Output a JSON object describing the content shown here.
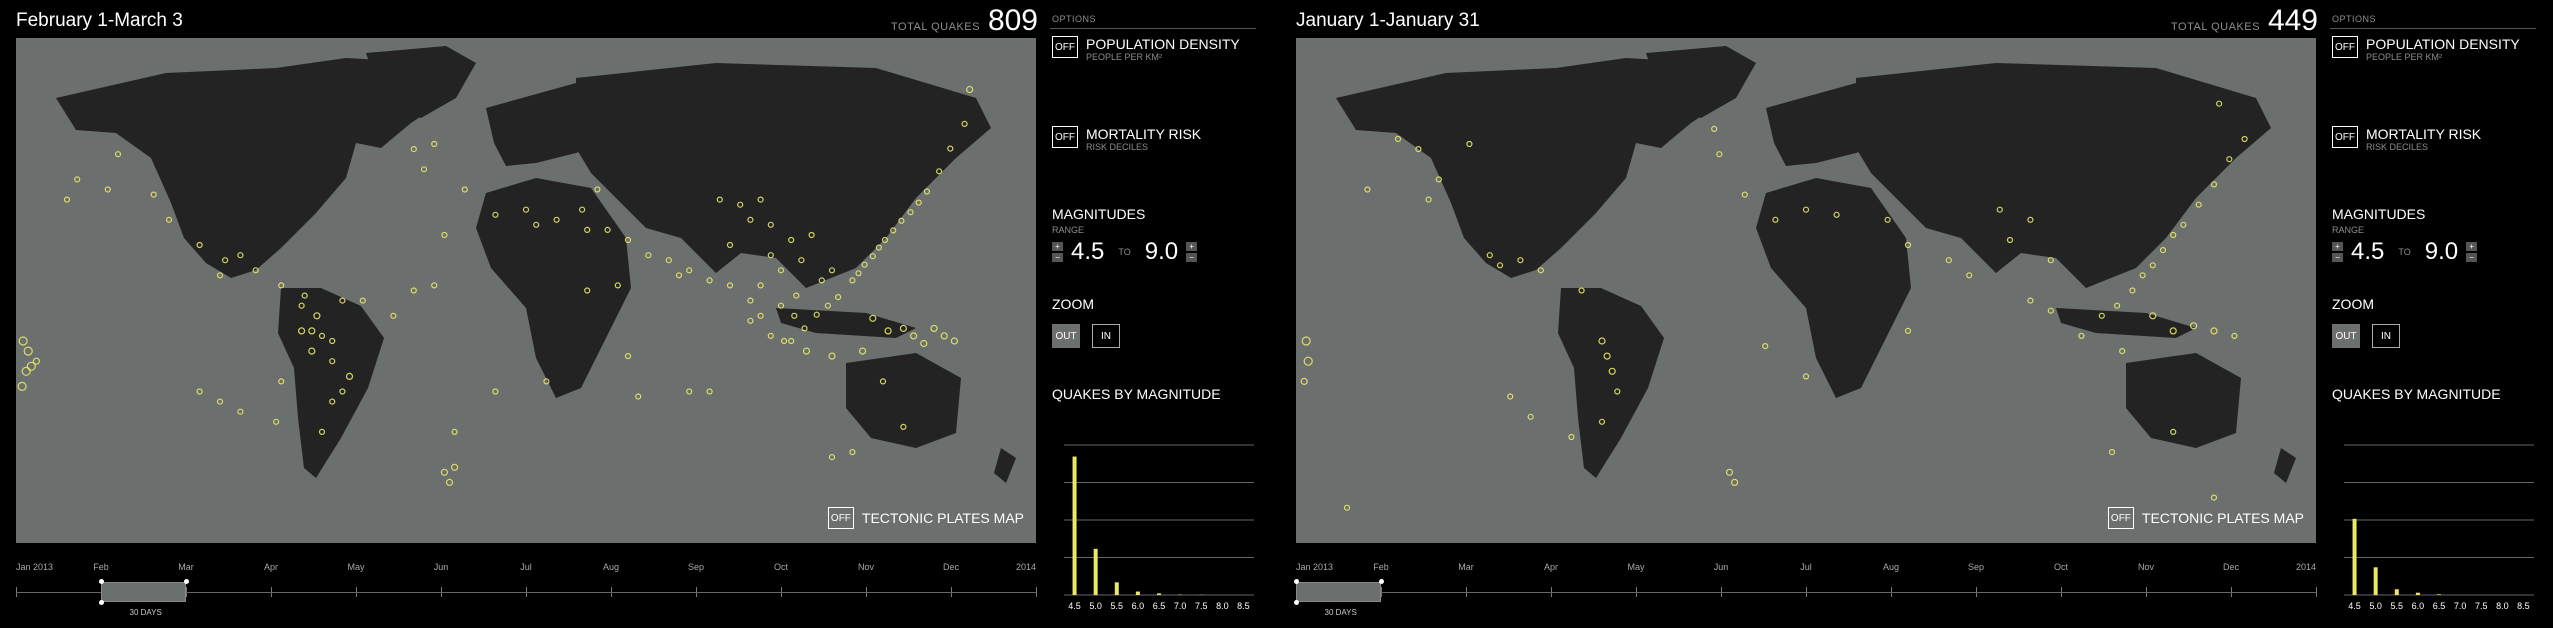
{
  "colors": {
    "map_ocean": "#6b6f6d",
    "land": "#232323",
    "quake": "#e8e86a",
    "background": "#000000"
  },
  "screens": [
    {
      "period_title": "February 1-March 3",
      "total_label": "TOTAL QUAKES",
      "total_value": "809",
      "tectonic_toggle": {
        "state": "OFF",
        "label": "TECTONIC PLATES MAP"
      },
      "timeline": {
        "months": [
          "Jan 2013",
          "Feb",
          "Mar",
          "Apr",
          "May",
          "Jun",
          "Jul",
          "Aug",
          "Sep",
          "Oct",
          "Nov",
          "Dec",
          "2014"
        ],
        "window_label": "30 DAYS",
        "window_start_month": 1,
        "window_span_months": 1.0
      },
      "options": {
        "heading": "OPTIONS",
        "population": {
          "state": "OFF",
          "title": "POPULATION DENSITY",
          "subtitle": "PEOPLE PER KM²"
        },
        "mortality": {
          "state": "OFF",
          "title": "MORTALITY RISK",
          "subtitle": "RISK DECILES"
        },
        "magnitudes": {
          "title": "MAGNITUDES",
          "range_label": "RANGE",
          "min": "4.5",
          "to": "TO",
          "max": "9.0"
        },
        "zoom": {
          "title": "ZOOM",
          "out": "OUT",
          "in": "IN",
          "active": "out"
        },
        "histogram_title": "QUAKES BY MAGNITUDE"
      },
      "chart_data": {
        "type": "bar",
        "categories": [
          "4.5",
          "5.0",
          "5.5",
          "6.0",
          "6.5",
          "7.0",
          "7.5",
          "8.0",
          "8.5"
        ],
        "values": [
          600,
          200,
          55,
          15,
          7,
          2,
          1,
          0,
          0
        ]
      },
      "quakes": [
        [
          0.935,
          0.102,
          2
        ],
        [
          0.916,
          0.219,
          1.5
        ],
        [
          0.905,
          0.264,
          1.5
        ],
        [
          0.893,
          0.304,
          1.5
        ],
        [
          0.885,
          0.326,
          1.5
        ],
        [
          0.877,
          0.345,
          1.5
        ],
        [
          0.868,
          0.362,
          1.5
        ],
        [
          0.86,
          0.381,
          1.5
        ],
        [
          0.852,
          0.4,
          1.5
        ],
        [
          0.846,
          0.415,
          1.5
        ],
        [
          0.84,
          0.432,
          1.5
        ],
        [
          0.832,
          0.449,
          1.5
        ],
        [
          0.826,
          0.466,
          1.5
        ],
        [
          0.82,
          0.48,
          1.5
        ],
        [
          0.806,
          0.513,
          1.5
        ],
        [
          0.796,
          0.53,
          1.5
        ],
        [
          0.785,
          0.548,
          1.5
        ],
        [
          0.773,
          0.575,
          1.5
        ],
        [
          0.753,
          0.6,
          1.5
        ],
        [
          0.72,
          0.56,
          1.5
        ],
        [
          0.73,
          0.55,
          1.5
        ],
        [
          0.79,
          0.48,
          1.5
        ],
        [
          0.8,
          0.46,
          1.5
        ],
        [
          0.84,
          0.555,
          2
        ],
        [
          0.87,
          0.575,
          2
        ],
        [
          0.88,
          0.59,
          2
        ],
        [
          0.9,
          0.575,
          2
        ],
        [
          0.91,
          0.59,
          2
        ],
        [
          0.92,
          0.6,
          2
        ],
        [
          0.89,
          0.605,
          2
        ],
        [
          0.855,
          0.58,
          2
        ],
        [
          0.83,
          0.62,
          2
        ],
        [
          0.8,
          0.63,
          2
        ],
        [
          0.775,
          0.62,
          2
        ],
        [
          0.76,
          0.6,
          1.5
        ],
        [
          0.74,
          0.59,
          1.5
        ],
        [
          0.765,
          0.51,
          1.5
        ],
        [
          0.763,
          0.55,
          1.5
        ],
        [
          0.75,
          0.53,
          1.5
        ],
        [
          0.73,
          0.49,
          1.5
        ],
        [
          0.72,
          0.52,
          1.5
        ],
        [
          0.7,
          0.49,
          1.5
        ],
        [
          0.68,
          0.48,
          1.5
        ],
        [
          0.66,
          0.46,
          1.5
        ],
        [
          0.64,
          0.44,
          1.5
        ],
        [
          0.62,
          0.43,
          1.5
        ],
        [
          0.6,
          0.4,
          1.5
        ],
        [
          0.58,
          0.38,
          1.5
        ],
        [
          0.56,
          0.38,
          1.5
        ],
        [
          0.555,
          0.34,
          1.5
        ],
        [
          0.57,
          0.3,
          1.5
        ],
        [
          0.72,
          0.36,
          1.5
        ],
        [
          0.74,
          0.37,
          1.5
        ],
        [
          0.76,
          0.4,
          1.5
        ],
        [
          0.78,
          0.39,
          1.5
        ],
        [
          0.7,
          0.41,
          1.5
        ],
        [
          0.74,
          0.43,
          1.5
        ],
        [
          0.77,
          0.44,
          1.5
        ],
        [
          0.75,
          0.46,
          1.5
        ],
        [
          0.71,
          0.33,
          1.5
        ],
        [
          0.69,
          0.32,
          1.5
        ],
        [
          0.73,
          0.32,
          1.5
        ],
        [
          0.53,
          0.36,
          1.5
        ],
        [
          0.51,
          0.37,
          1.5
        ],
        [
          0.5,
          0.34,
          1.5
        ],
        [
          0.47,
          0.35,
          1.5
        ],
        [
          0.44,
          0.3,
          1.5
        ],
        [
          0.42,
          0.39,
          1.5
        ],
        [
          0.31,
          0.64,
          1.5
        ],
        [
          0.3,
          0.59,
          1.5
        ],
        [
          0.31,
          0.6,
          1.5
        ],
        [
          0.327,
          0.67,
          2
        ],
        [
          0.32,
          0.7,
          1.5
        ],
        [
          0.31,
          0.72,
          1.5
        ],
        [
          0.3,
          0.78,
          1.5
        ],
        [
          0.29,
          0.58,
          2
        ],
        [
          0.28,
          0.53,
          1.5
        ],
        [
          0.26,
          0.49,
          1.5
        ],
        [
          0.235,
          0.46,
          1.5
        ],
        [
          0.22,
          0.43,
          1.5
        ],
        [
          0.205,
          0.44,
          1.5
        ],
        [
          0.18,
          0.41,
          1.5
        ],
        [
          0.2,
          0.47,
          1.5
        ],
        [
          0.283,
          0.51,
          1.5
        ],
        [
          0.29,
          0.62,
          2
        ],
        [
          0.295,
          0.55,
          2
        ],
        [
          0.28,
          0.58,
          2
        ],
        [
          0.32,
          0.52,
          1.5
        ],
        [
          0.34,
          0.52,
          1.5
        ],
        [
          0.37,
          0.55,
          1.5
        ],
        [
          0.39,
          0.5,
          1.5
        ],
        [
          0.41,
          0.49,
          1.5
        ],
        [
          0.47,
          0.7,
          1.5
        ],
        [
          0.43,
          0.78,
          1.5
        ],
        [
          0.42,
          0.86,
          2
        ],
        [
          0.43,
          0.85,
          2
        ],
        [
          0.425,
          0.88,
          2
        ],
        [
          0.255,
          0.76,
          1.5
        ],
        [
          0.26,
          0.68,
          1.5
        ],
        [
          0.22,
          0.74,
          1.5
        ],
        [
          0.2,
          0.72,
          1.5
        ],
        [
          0.18,
          0.7,
          1.5
        ],
        [
          0.1,
          0.23,
          1.5
        ],
        [
          0.09,
          0.3,
          1.5
        ],
        [
          0.06,
          0.28,
          1.5
        ],
        [
          0.05,
          0.32,
          1.5
        ],
        [
          0.135,
          0.31,
          1.5
        ],
        [
          0.15,
          0.36,
          1.5
        ],
        [
          0.39,
          0.22,
          1.5
        ],
        [
          0.4,
          0.26,
          1.5
        ],
        [
          0.41,
          0.21,
          1.5
        ],
        [
          0.007,
          0.6,
          3
        ],
        [
          0.012,
          0.62,
          3
        ],
        [
          0.015,
          0.65,
          3
        ],
        [
          0.01,
          0.66,
          3
        ],
        [
          0.006,
          0.69,
          3
        ],
        [
          0.02,
          0.64,
          2
        ],
        [
          0.61,
          0.71,
          1.5
        ],
        [
          0.66,
          0.7,
          1.5
        ],
        [
          0.68,
          0.7,
          1.5
        ],
        [
          0.8,
          0.83,
          1.5
        ],
        [
          0.82,
          0.82,
          1.5
        ],
        [
          0.87,
          0.77,
          1.5
        ],
        [
          0.85,
          0.68,
          1.5
        ],
        [
          0.56,
          0.5,
          1.5
        ],
        [
          0.59,
          0.49,
          1.5
        ],
        [
          0.65,
          0.47,
          1.5
        ],
        [
          0.6,
          0.63,
          1.5
        ],
        [
          0.52,
          0.68,
          1.5
        ],
        [
          0.93,
          0.17,
          1.5
        ]
      ]
    },
    {
      "period_title": "January 1-January 31",
      "total_label": "TOTAL QUAKES",
      "total_value": "449",
      "tectonic_toggle": {
        "state": "OFF",
        "label": "TECTONIC PLATES MAP"
      },
      "timeline": {
        "months": [
          "Jan 2013",
          "Feb",
          "Mar",
          "Apr",
          "May",
          "Jun",
          "Jul",
          "Aug",
          "Sep",
          "Oct",
          "Nov",
          "Dec",
          "2014"
        ],
        "window_label": "30 DAYS",
        "window_start_month": 0,
        "window_span_months": 1.0
      },
      "options": {
        "heading": "OPTIONS",
        "population": {
          "state": "OFF",
          "title": "POPULATION DENSITY",
          "subtitle": "PEOPLE PER KM²"
        },
        "mortality": {
          "state": "OFF",
          "title": "MORTALITY RISK",
          "subtitle": "RISK DECILES"
        },
        "magnitudes": {
          "title": "MAGNITUDES",
          "range_label": "RANGE",
          "min": "4.5",
          "to": "TO",
          "max": "9.0"
        },
        "zoom": {
          "title": "ZOOM",
          "out": "OUT",
          "in": "IN",
          "active": "out"
        },
        "histogram_title": "QUAKES BY MAGNITUDE"
      },
      "chart_data": {
        "type": "bar",
        "categories": [
          "4.5",
          "5.0",
          "5.5",
          "6.0",
          "6.5",
          "7.0",
          "7.5",
          "8.0",
          "8.5"
        ],
        "values": [
          330,
          120,
          25,
          10,
          3,
          0,
          0,
          0,
          0
        ]
      },
      "quakes": [
        [
          0.905,
          0.13,
          1.5
        ],
        [
          0.93,
          0.2,
          1.5
        ],
        [
          0.915,
          0.24,
          1.5
        ],
        [
          0.9,
          0.29,
          1.5
        ],
        [
          0.885,
          0.33,
          1.5
        ],
        [
          0.87,
          0.37,
          1.5
        ],
        [
          0.86,
          0.39,
          1.5
        ],
        [
          0.85,
          0.42,
          1.5
        ],
        [
          0.84,
          0.45,
          1.5
        ],
        [
          0.83,
          0.47,
          1.5
        ],
        [
          0.82,
          0.5,
          1.5
        ],
        [
          0.805,
          0.53,
          1.5
        ],
        [
          0.79,
          0.55,
          1.5
        ],
        [
          0.77,
          0.59,
          1.5
        ],
        [
          0.84,
          0.55,
          2
        ],
        [
          0.86,
          0.58,
          2
        ],
        [
          0.88,
          0.57,
          2
        ],
        [
          0.9,
          0.58,
          2
        ],
        [
          0.92,
          0.59,
          1.5
        ],
        [
          0.81,
          0.62,
          1.5
        ],
        [
          0.74,
          0.54,
          1.5
        ],
        [
          0.72,
          0.52,
          1.5
        ],
        [
          0.72,
          0.36,
          1.5
        ],
        [
          0.7,
          0.4,
          1.5
        ],
        [
          0.74,
          0.44,
          1.5
        ],
        [
          0.69,
          0.34,
          1.5
        ],
        [
          0.66,
          0.47,
          1.5
        ],
        [
          0.64,
          0.44,
          1.5
        ],
        [
          0.6,
          0.41,
          1.5
        ],
        [
          0.58,
          0.36,
          1.5
        ],
        [
          0.53,
          0.35,
          1.5
        ],
        [
          0.5,
          0.34,
          1.5
        ],
        [
          0.47,
          0.36,
          1.5
        ],
        [
          0.44,
          0.31,
          1.5
        ],
        [
          0.415,
          0.23,
          1.5
        ],
        [
          0.41,
          0.18,
          1.5
        ],
        [
          0.3,
          0.6,
          2
        ],
        [
          0.305,
          0.63,
          2
        ],
        [
          0.31,
          0.66,
          2
        ],
        [
          0.315,
          0.7,
          1.5
        ],
        [
          0.3,
          0.76,
          1.5
        ],
        [
          0.28,
          0.5,
          1.5
        ],
        [
          0.24,
          0.46,
          1.5
        ],
        [
          0.22,
          0.44,
          1.5
        ],
        [
          0.2,
          0.45,
          1.5
        ],
        [
          0.19,
          0.43,
          1.5
        ],
        [
          0.27,
          0.79,
          1.5
        ],
        [
          0.23,
          0.75,
          1.5
        ],
        [
          0.21,
          0.71,
          1.5
        ],
        [
          0.1,
          0.2,
          1.5
        ],
        [
          0.12,
          0.22,
          1.5
        ],
        [
          0.14,
          0.28,
          1.5
        ],
        [
          0.13,
          0.32,
          1.5
        ],
        [
          0.17,
          0.21,
          1.5
        ],
        [
          0.07,
          0.3,
          1.5
        ],
        [
          0.01,
          0.6,
          3
        ],
        [
          0.012,
          0.64,
          3
        ],
        [
          0.008,
          0.68,
          2
        ],
        [
          0.43,
          0.88,
          2
        ],
        [
          0.425,
          0.86,
          2
        ],
        [
          0.05,
          0.93,
          1.5
        ],
        [
          0.6,
          0.58,
          1.5
        ],
        [
          0.46,
          0.61,
          1.5
        ],
        [
          0.5,
          0.67,
          1.5
        ],
        [
          0.8,
          0.82,
          1.5
        ],
        [
          0.86,
          0.78,
          1.5
        ],
        [
          0.9,
          0.91,
          1.5
        ]
      ]
    }
  ]
}
